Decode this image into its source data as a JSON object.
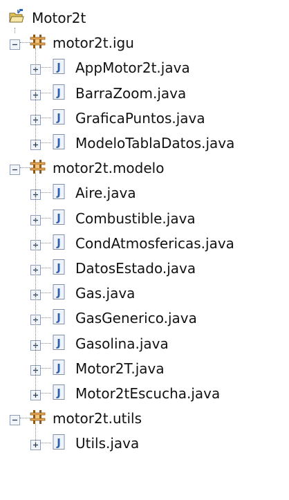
{
  "tree": {
    "project": {
      "label": "Motor2t",
      "icon": "project-folder-icon",
      "expanded": true
    },
    "packages": [
      {
        "label": "motor2t.igu",
        "icon": "package-icon",
        "expanded": true,
        "files": [
          {
            "label": "AppMotor2t.java",
            "icon": "java-file-icon"
          },
          {
            "label": "BarraZoom.java",
            "icon": "java-file-icon"
          },
          {
            "label": "GraficaPuntos.java",
            "icon": "java-file-icon"
          },
          {
            "label": "ModeloTablaDatos.java",
            "icon": "java-file-icon"
          }
        ]
      },
      {
        "label": "motor2t.modelo",
        "icon": "package-icon",
        "expanded": true,
        "files": [
          {
            "label": "Aire.java",
            "icon": "java-file-icon"
          },
          {
            "label": "Combustible.java",
            "icon": "java-file-icon"
          },
          {
            "label": "CondAtmosfericas.java",
            "icon": "java-file-icon"
          },
          {
            "label": "DatosEstado.java",
            "icon": "java-file-icon"
          },
          {
            "label": "Gas.java",
            "icon": "java-file-icon"
          },
          {
            "label": "GasGenerico.java",
            "icon": "java-file-icon"
          },
          {
            "label": "Gasolina.java",
            "icon": "java-file-icon"
          },
          {
            "label": "Motor2T.java",
            "icon": "java-file-icon"
          },
          {
            "label": "Motor2tEscucha.java",
            "icon": "java-file-icon"
          }
        ]
      },
      {
        "label": "motor2t.utils",
        "icon": "package-icon",
        "expanded": true,
        "files": [
          {
            "label": "Utils.java",
            "icon": "java-file-icon"
          }
        ]
      }
    ]
  },
  "colors": {
    "package_brown": "#8b5a1a",
    "package_light": "#e8a956",
    "java_blue": "#2f5faa",
    "folder_yellow": "#e3c15a",
    "tree_line": "#8a8a8a"
  }
}
